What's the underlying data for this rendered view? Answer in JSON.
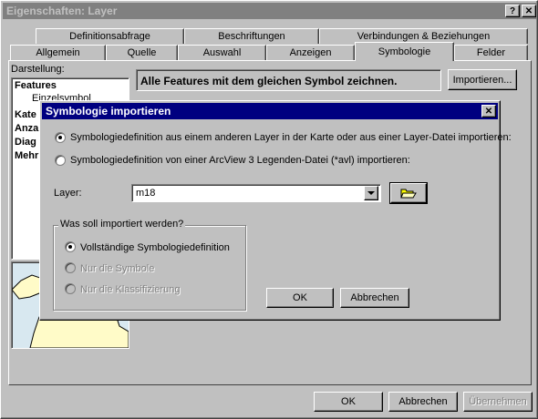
{
  "main_window": {
    "title": "Eigenschaften: Layer",
    "help_button": "?",
    "close_button": "✕",
    "tabs_row1": [
      "Definitionsabfrage",
      "Beschriftungen",
      "Verbindungen & Beziehungen"
    ],
    "tabs_row2": [
      "Allgemein",
      "Quelle",
      "Auswahl",
      "Anzeigen",
      "Symbologie",
      "Felder"
    ],
    "active_tab": "Symbologie",
    "show_label": "Darstellung:",
    "tree_items": [
      "Features",
      "Einzelsymbol",
      "Kate",
      "Anza",
      "Diag",
      "Mehr"
    ],
    "description": "Alle Features mit dem gleichen Symbol zeichnen.",
    "import_button": "Importieren...",
    "ok_button": "OK",
    "cancel_button": "Abbrechen",
    "apply_button": "Übernehmen"
  },
  "dialog": {
    "title": "Symbologie importieren",
    "close_button": "✕",
    "option1": "Symbologiedefinition aus einem anderen Layer in der Karte oder aus einer Layer-Datei importieren:",
    "option2": "Symbologiedefinition von einer ArcView 3 Legenden-Datei (*avl) importieren:",
    "layer_label": "Layer:",
    "layer_value": "m18",
    "group_title": "Was soll importiert werden?",
    "group_opt1": "Vollständige Symbologiedefinition",
    "group_opt2": "Nur die Symbole",
    "group_opt3": "Nur die Klassifizierung",
    "ok_button": "OK",
    "cancel_button": "Abbrechen"
  },
  "colors": {
    "title_inactive": "#808080",
    "title_active": "#000080",
    "face": "#c0c0c0",
    "map_water": "#d8e8f0",
    "map_land": "#fffbc8"
  }
}
